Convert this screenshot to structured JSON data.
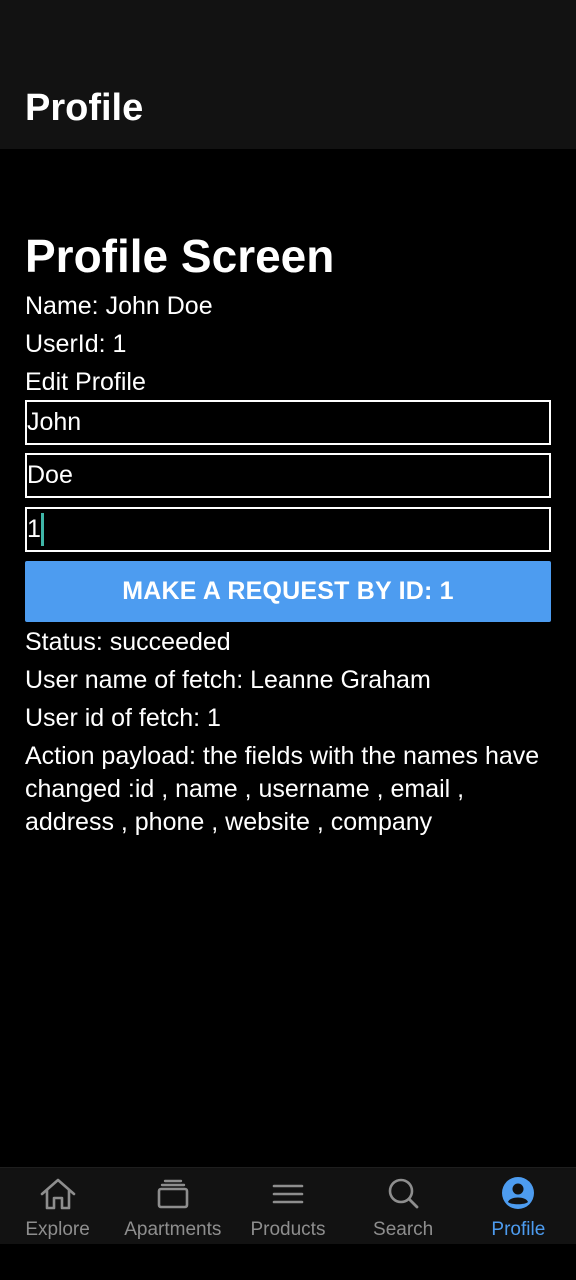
{
  "header": {
    "title": "Profile"
  },
  "screen": {
    "title": "Profile Screen",
    "name_line": "Name: John Doe",
    "userid_line": "UserId: 1",
    "edit_label": "Edit Profile"
  },
  "form": {
    "first_name_value": "John",
    "last_name_value": "Doe",
    "id_value": "1"
  },
  "button": {
    "label": "MAKE A REQUEST BY ID: 1"
  },
  "results": {
    "status": "Status: succeeded",
    "user_name": "User name of fetch: Leanne Graham",
    "user_id": "User id of fetch: 1",
    "payload": "Action payload: the fields with the names have changed :id , name , username , email , address , phone , website , company"
  },
  "tabs": [
    {
      "label": "Explore",
      "icon": "home-icon"
    },
    {
      "label": "Apartments",
      "icon": "cards-icon"
    },
    {
      "label": "Products",
      "icon": "menu-icon"
    },
    {
      "label": "Search",
      "icon": "search-icon"
    },
    {
      "label": "Profile",
      "icon": "user-circle-icon"
    }
  ],
  "colors": {
    "accent": "#4d9cf0",
    "inactive_tab": "#8e8e8e",
    "header_bg": "#121212",
    "caret": "#3fb6a8"
  }
}
